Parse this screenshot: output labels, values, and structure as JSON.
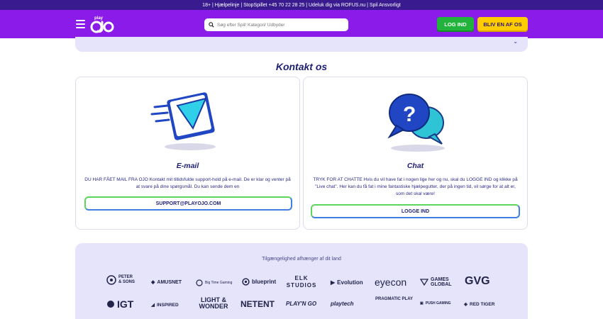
{
  "topbar": {
    "text": "18+ | Hjælpelinje | StopSpillet +45 70 22 28 25 | Udeluk dig via ROFUS.nu | Spil Ansvorligt"
  },
  "header": {
    "logo_text": "play ojo",
    "search_placeholder": "Søg efter Spil/ Kategori/ Udbyder",
    "login_label": "LOG IND",
    "join_label": "BLIV EN AF OS"
  },
  "contact": {
    "title": "Kontakt os",
    "email": {
      "title": "E-mail",
      "description": "DU HAR FÅET MAIL FRA OJO Kontakt mit tillidsfulde support-hold på e-mail. De er klar og venter på at svare på dine spørgsmål. Du kan sende dem en",
      "button_label": "SUPPORT@PLAYOJO.COM"
    },
    "chat": {
      "title": "Chat",
      "description": "TRYK FOR AT CHATTE Hvis du vil have fat i nogen lige her og nu, skal du LOGGE IND og klikke på \"Live chat\". Her kan du få fat i mine fantastiske hjælpegutter, der på ingen tid, vil sørge for at alt er, som det skal være!",
      "button_label": "LOGGE IND"
    }
  },
  "providers": {
    "title": "Tilgængelighed afhænger af dit land",
    "row1": [
      "PETER & SONS",
      "AMUSNET",
      "Big Time Gaming",
      "blueprint",
      "ELK STUDIOS",
      "Evolution",
      "eyecon",
      "GAMES GLOBAL",
      "GVG"
    ],
    "row2": [
      "IGT",
      "INSPIRED",
      "LIGHT & WONDER",
      "NETENT",
      "PLAY'N GO",
      "playtech",
      "PRAGMATIC PLAY",
      "PUSH GAMING",
      "RED TIGER"
    ]
  },
  "colors": {
    "header_bg": "#8a1be8",
    "topbar_bg": "#3a1a8f",
    "login": "#22b33c",
    "join": "#ffcc00",
    "panel": "#e6e4fb"
  }
}
